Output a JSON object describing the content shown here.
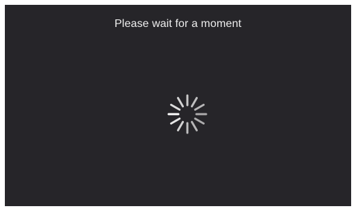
{
  "dialog": {
    "message": "Please wait for a moment"
  },
  "spinner": {
    "icon": "loading-spinner-icon",
    "color": "#e6e6e6",
    "background": "#262529"
  }
}
